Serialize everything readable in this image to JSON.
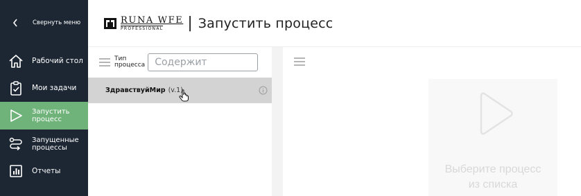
{
  "sidebar": {
    "collapse_label": "Свернуть меню",
    "items": [
      {
        "label": "Рабочий стол",
        "icon": "home-icon"
      },
      {
        "label": "Мои задачи",
        "icon": "clipboard-check-icon"
      },
      {
        "label": "Запустить процесс",
        "icon": "play-icon",
        "active": true
      },
      {
        "label": "Запущенные процессы",
        "icon": "process-flow-icon"
      },
      {
        "label": "Отчеты",
        "icon": "report-chart-icon"
      }
    ],
    "active_color": "#6fb37a",
    "background": "#1d2734"
  },
  "header": {
    "logo_main": "RUNA WFE",
    "logo_sub": "PROFESSIONAL",
    "separator": "|",
    "title": "Запустить процесс"
  },
  "list": {
    "filter_label_line1": "Тип",
    "filter_label_line2": "процесса",
    "filter_placeholder": "Содержит",
    "filter_value": "",
    "rows": [
      {
        "name": "ЗдравствуйМир",
        "version": "(v.1)",
        "selected": true
      }
    ]
  },
  "detail": {
    "empty_line1": "Выберите процесс",
    "empty_line2": "из списка"
  }
}
